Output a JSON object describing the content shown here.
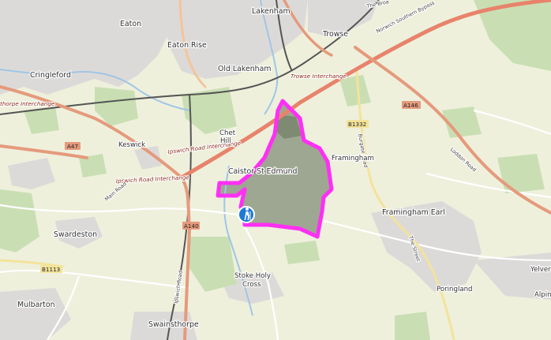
{
  "map": {
    "type": "topographic-street-map",
    "route_color": "#ff2ff5",
    "start_marker_color": "#1f78d1",
    "start_marker_icon": "hiker-icon",
    "places": [
      {
        "id": "lakenham",
        "label": "Lakenham"
      },
      {
        "id": "eaton",
        "label": "Eaton"
      },
      {
        "id": "eaton-rise",
        "label": "Eaton Rise"
      },
      {
        "id": "trowse",
        "label": "Trowse"
      },
      {
        "id": "old-lakenham",
        "label": "Old Lakenham"
      },
      {
        "id": "cringleford",
        "label": "Cringleford"
      },
      {
        "id": "keswick",
        "label": "Keswick"
      },
      {
        "id": "caistor",
        "label": "Caistor St Edmund"
      },
      {
        "id": "framingham",
        "label": "Framingham"
      },
      {
        "id": "framingham-earl",
        "label": "Framingham Earl"
      },
      {
        "id": "swardeston",
        "label": "Swardeston"
      },
      {
        "id": "stoke-holy-cross",
        "label": "Stoke Holy Cross"
      },
      {
        "id": "poringland",
        "label": "Poringland"
      },
      {
        "id": "mulbarton",
        "label": "Mulbarton"
      },
      {
        "id": "swainsthorpe",
        "label": "Swainsthorpe"
      },
      {
        "id": "yelverton",
        "label": "Yelvert"
      },
      {
        "id": "alpington",
        "label": "Alpin"
      },
      {
        "id": "chet",
        "label": "Chet"
      },
      {
        "id": "hill",
        "label": "Hill"
      }
    ],
    "road_labels": {
      "trowse_interchange": "Trowse Interchange",
      "ipswich_road_interchange": "Ipswich Road Interchange",
      "ipswich_road_interchange_2": "Ipswich Road Interchange",
      "thorpe_interchange": "thorpe Interchange",
      "main_road": "Main Road",
      "ipswich_road": "Ipswich Road",
      "loddon_road": "Loddon Road",
      "burgate_road": "Burgate Road",
      "the_street": "The Street",
      "norwich_southern_bypass": "Norwich Southern Bypass",
      "the_broad": "The Broa"
    },
    "shields": {
      "a47": "A47",
      "a140": "A140",
      "a146": "A146",
      "b1332": "B1332",
      "b1113": "B1113"
    },
    "chart_data": null
  }
}
